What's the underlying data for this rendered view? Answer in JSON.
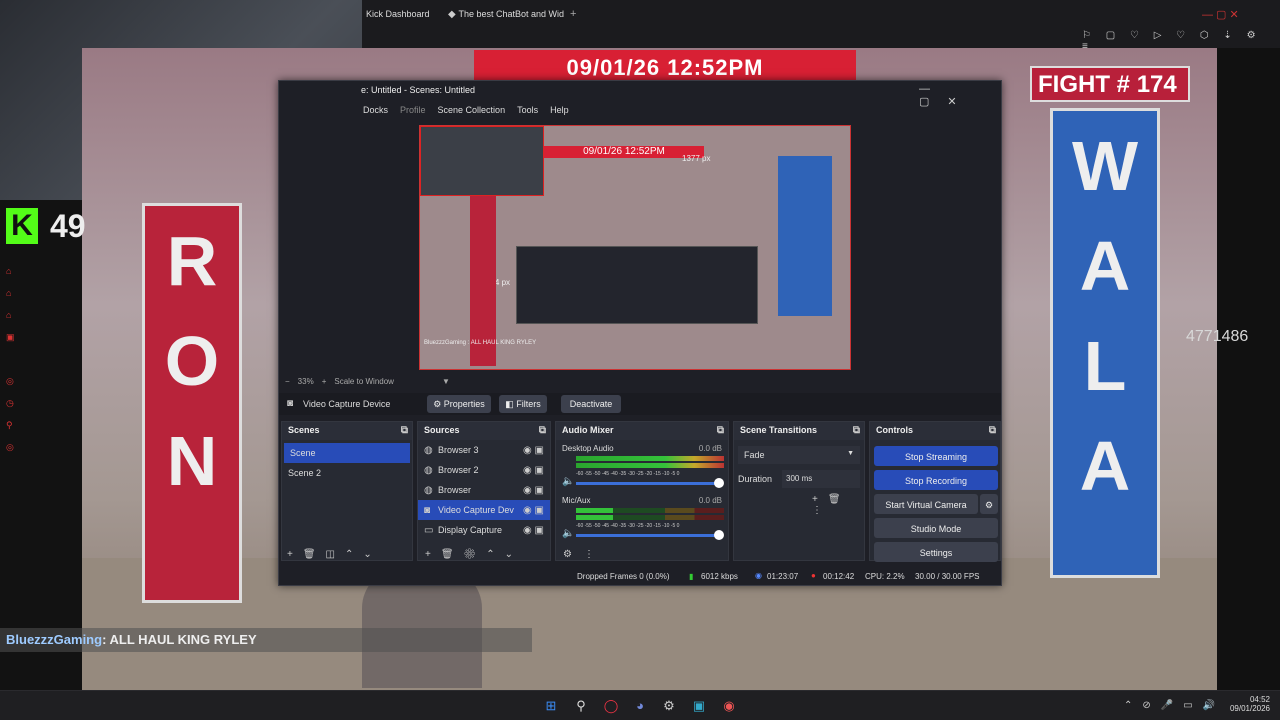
{
  "browser": {
    "tabs": [
      {
        "label": "Kick Dashboard",
        "icon": "kick-icon"
      },
      {
        "label": "The best ChatBot and Wid",
        "icon": "chatbot-icon"
      }
    ],
    "new_tab": "+"
  },
  "overlay": {
    "datetime": "09/01/26 12:52PM",
    "fight_label": "FIGHT #",
    "fight_number": "174",
    "kick_count": "49",
    "viewer_number": "4771486",
    "chat_user": "BluezzzGaming",
    "chat_message": ": ALL HAUL KING RYLEY",
    "banner_left": [
      "R",
      "O",
      "N"
    ],
    "banner_right": [
      "W",
      "A",
      "L",
      "A"
    ]
  },
  "obs": {
    "title": "e: Untitled - Scenes: Untitled",
    "menu": [
      "Docks",
      "Profile",
      "Scene Collection",
      "Tools",
      "Help"
    ],
    "preview_labels": {
      "width": "1377 px",
      "height": "774 px"
    },
    "zoom": "33%",
    "scale_mode": "Scale to Window",
    "source_toolbar": {
      "source_name": "Video Capture Device",
      "properties": "Properties",
      "filters": "Filters",
      "deactivate": "Deactivate"
    },
    "scenes": {
      "title": "Scenes",
      "items": [
        "Scene",
        "Scene 2"
      ],
      "selected": 0
    },
    "sources": {
      "title": "Sources",
      "items": [
        "Browser 3",
        "Browser 2",
        "Browser",
        "Video Capture Dev",
        "Display Capture"
      ],
      "selected": 3
    },
    "mixer": {
      "title": "Audio Mixer",
      "channels": [
        {
          "name": "Desktop Audio",
          "db": "0.0 dB"
        },
        {
          "name": "Mic/Aux",
          "db": "0.0 dB"
        }
      ],
      "scale": "-60 -55 -50 -45 -40 -35 -30 -25 -20 -15 -10 -5 0"
    },
    "transitions": {
      "title": "Scene Transitions",
      "type": "Fade",
      "duration_label": "Duration",
      "duration_value": "300 ms"
    },
    "controls": {
      "title": "Controls",
      "stop_streaming": "Stop Streaming",
      "stop_recording": "Stop Recording",
      "virtual_camera": "Start Virtual Camera",
      "studio_mode": "Studio Mode",
      "settings": "Settings"
    },
    "status": {
      "dropped": "Dropped Frames 0 (0.0%)",
      "bitrate": "6012 kbps",
      "stream_time": "01:23:07",
      "rec_time": "00:12:42",
      "cpu": "CPU: 2.2%",
      "fps": "30.00 / 30.00 FPS"
    }
  },
  "taskbar": {
    "time": "04:52",
    "date": "09/01/2026"
  },
  "colors": {
    "accent": "#284cb8",
    "kick_green": "#53fc18",
    "red": "#e0302f"
  }
}
